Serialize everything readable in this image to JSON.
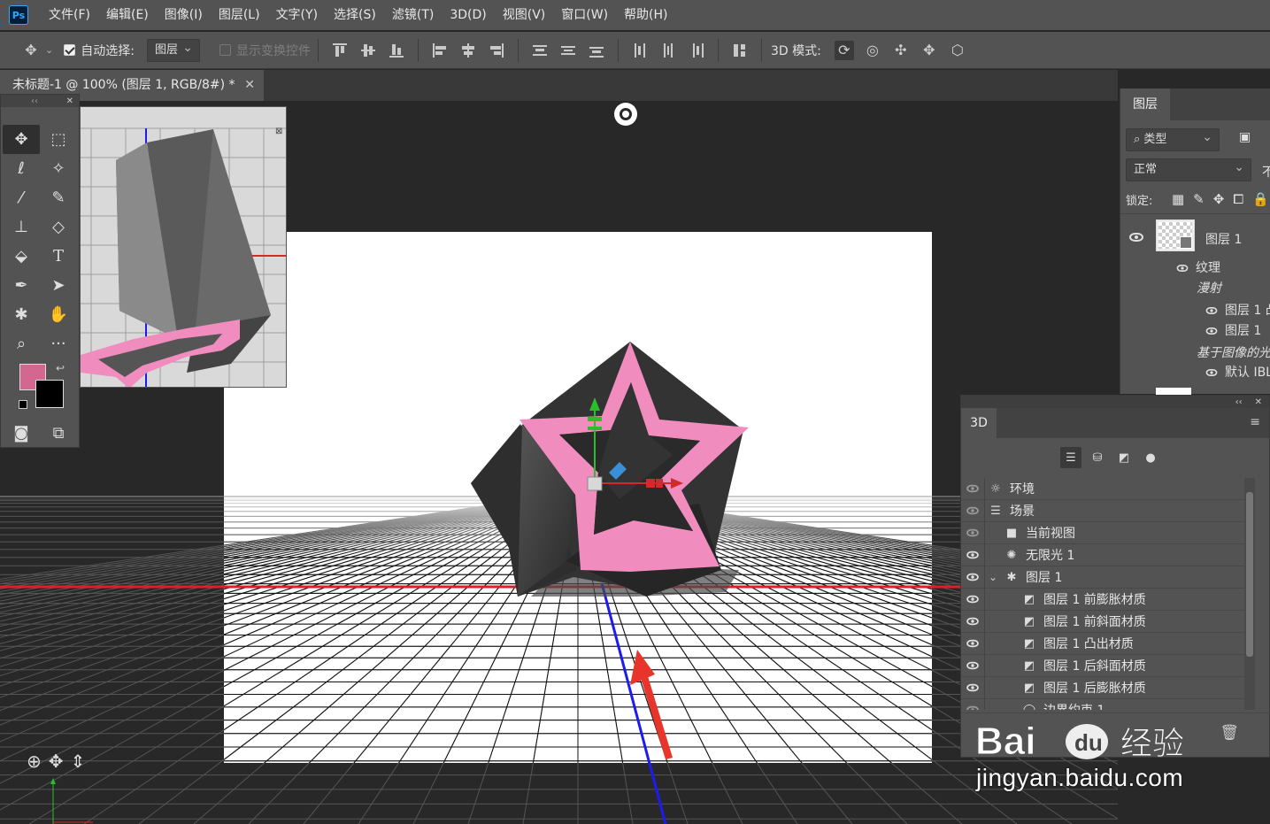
{
  "app": {
    "logo": "Ps",
    "menu": [
      "文件(F)",
      "编辑(E)",
      "图像(I)",
      "图层(L)",
      "文字(Y)",
      "选择(S)",
      "滤镜(T)",
      "3D(D)",
      "视图(V)",
      "窗口(W)",
      "帮助(H)"
    ]
  },
  "options": {
    "auto_select_label": "自动选择:",
    "auto_select_target": "图层",
    "show_transform_label": "显示变换控件",
    "mode3d_label": "3D 模式:"
  },
  "document": {
    "tab_title": "未标题-1 @ 100% (图层 1, RGB/8#) *",
    "close": "✕"
  },
  "colors": {
    "foreground": "#d4678f",
    "background": "#000000",
    "star_pink": "#f08cbe",
    "x_axis": "#e02020",
    "y_axis": "#1c1cf0",
    "accent_arrow": "#e8352b"
  },
  "layers_panel": {
    "tab": "图层",
    "filter_label": "类型",
    "blend_mode": "正常",
    "lock_label": "锁定:",
    "layer_name": "图层 1",
    "texture_label": "纹理",
    "diffuse_label": "漫射",
    "sub_items": [
      "图层 1 凸",
      "图层 1"
    ],
    "ibl_group": "基于图像的光",
    "ibl_default": "默认 IBL",
    "opacity_clip": "不"
  },
  "panel3d": {
    "tab": "3D",
    "rows": [
      {
        "label": "环境",
        "icon": "☼",
        "indent": 0,
        "dim": true
      },
      {
        "label": "场景",
        "icon": "☰",
        "indent": 0,
        "dim": true
      },
      {
        "label": "当前视图",
        "icon": "■",
        "indent": 1,
        "dim": true
      },
      {
        "label": "无限光 1",
        "icon": "✺",
        "indent": 1,
        "dim": false
      },
      {
        "label": "图层 1",
        "icon": "✱",
        "indent": 1,
        "dim": false,
        "selected": true
      },
      {
        "label": "图层 1 前膨胀材质",
        "icon": "◩",
        "indent": 2,
        "dim": false
      },
      {
        "label": "图层 1 前斜面材质",
        "icon": "◩",
        "indent": 2,
        "dim": false
      },
      {
        "label": "图层 1 凸出材质",
        "icon": "◩",
        "indent": 2,
        "dim": false
      },
      {
        "label": "图层 1 后斜面材质",
        "icon": "◩",
        "indent": 2,
        "dim": false
      },
      {
        "label": "图层 1 后膨胀材质",
        "icon": "◩",
        "indent": 2,
        "dim": false
      },
      {
        "label": "边界约束 1",
        "icon": "◯",
        "indent": 2,
        "dim": true
      }
    ]
  },
  "watermark": {
    "brand": "Bai 经验",
    "url": "jingyan.baidu.com"
  }
}
